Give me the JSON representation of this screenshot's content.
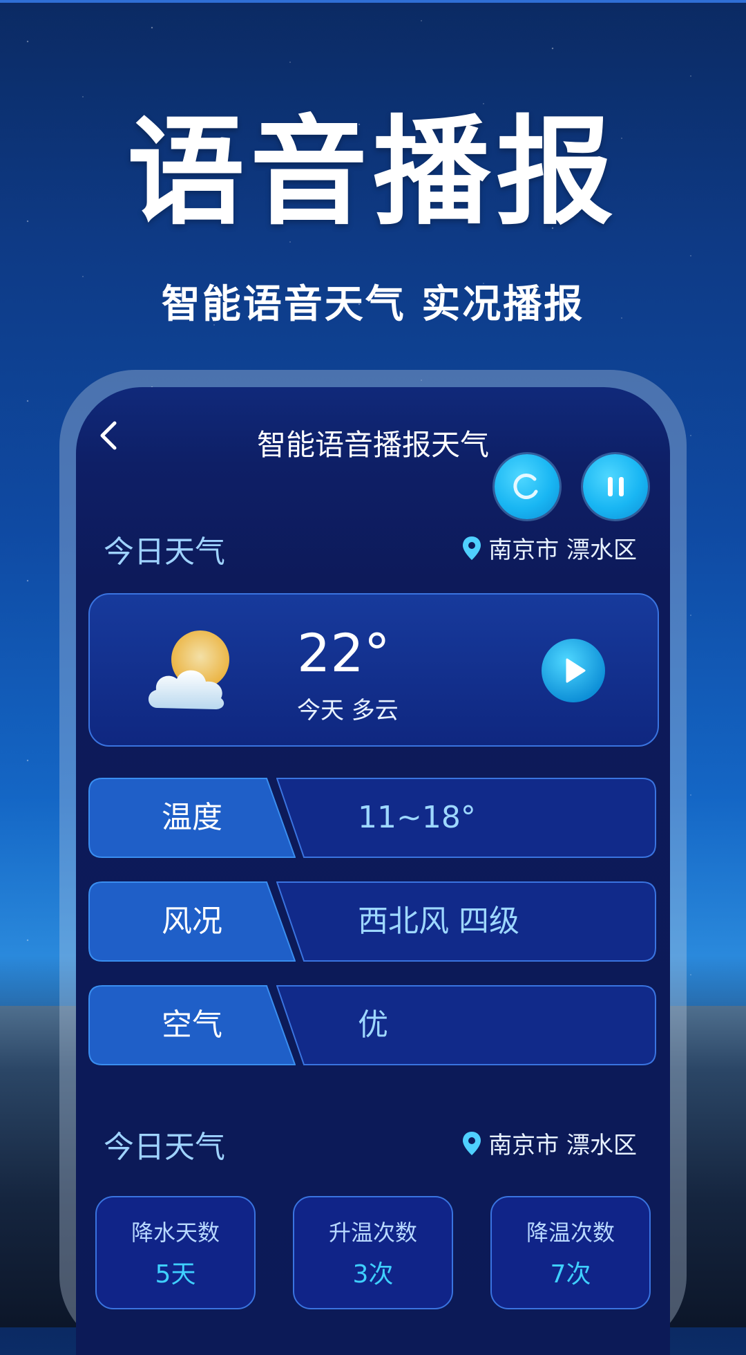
{
  "hero": {
    "title": "语音播报",
    "subtitle": "智能语音天气 实况播报"
  },
  "app": {
    "nav_title": "智能语音播报天气",
    "today": {
      "section_title": "今日天气",
      "location": "南京市 漂水区",
      "temperature": "22°",
      "condition": "今天 多云"
    },
    "details": [
      {
        "label": "温度",
        "value": "11~18°"
      },
      {
        "label": "风况",
        "value": "西北风 四级"
      },
      {
        "label": "空气",
        "value": "优"
      }
    ],
    "stats_section": {
      "section_title": "今日天气",
      "location": "南京市 漂水区"
    },
    "stats": [
      {
        "label": "降水天数",
        "value": "5天"
      },
      {
        "label": "升温次数",
        "value": "3次"
      },
      {
        "label": "降温次数",
        "value": "7次"
      }
    ]
  },
  "colors": {
    "accent": "#19b6f3",
    "card_border": "#3a74e0",
    "label_fill": "#1f5fc8",
    "value_text": "#9ed8ff"
  }
}
